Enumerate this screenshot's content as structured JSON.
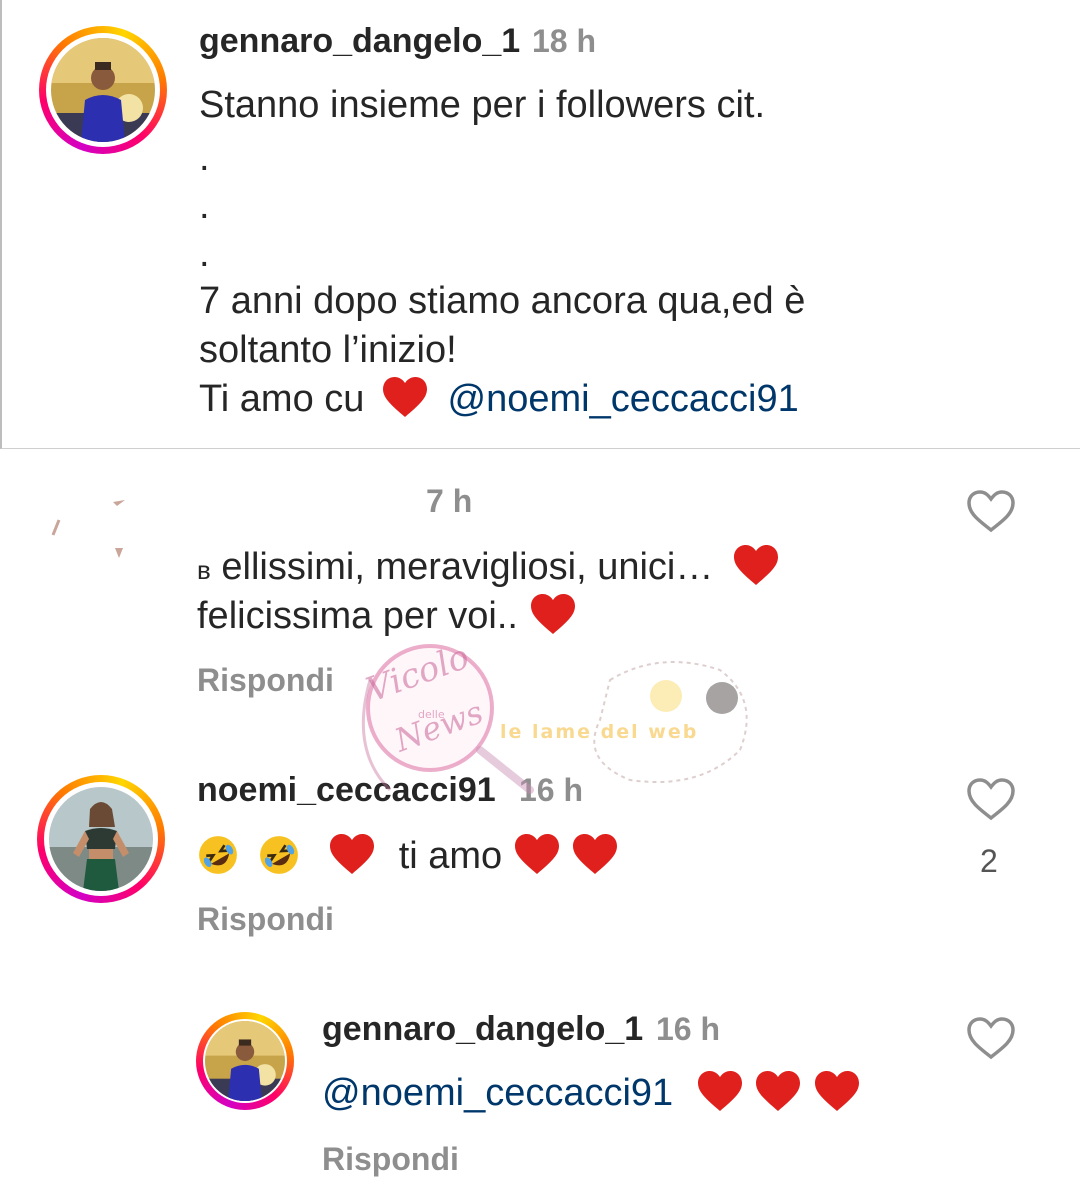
{
  "caption": {
    "username": "gennaro_dangelo_1",
    "time": "18 h",
    "line1": "Stanno insieme per i followers cit.",
    "dots": [
      ".",
      ".",
      "."
    ],
    "line2": "7 anni dopo stiamo ancora qua,ed è",
    "line3": "soltanto l’inizio!",
    "line4_prefix": "Ti amo cu",
    "line4_mention": "@noemi_ceccacci91"
  },
  "comments": [
    {
      "username": "",
      "time": "7 h",
      "line1": "ellissimi, meravigliosi, unici…",
      "line1_cut": "ʙ",
      "line2": "felicissima per voi..",
      "reply_label": "Rispondi"
    },
    {
      "username": "noemi_ceccacci91",
      "time": "16 h",
      "text": "ti amo",
      "reply_label": "Rispondi",
      "like_count": "2"
    },
    {
      "username": "gennaro_dangelo_1",
      "time": "16 h",
      "mention": "@noemi_ceccacci91",
      "reply_label": "Rispondi"
    }
  ],
  "watermark": {
    "left_text": "Vicolo",
    "left_small": "delle",
    "left_text2": "News",
    "right_text": "le lame del web"
  },
  "icons": {
    "heart_outline": "heart-outline-icon",
    "heart_red": "red-heart-emoji",
    "laugh": "rolling-on-floor-laughing-emoji"
  },
  "colors": {
    "mention": "#00376b",
    "heart": "#e0201c",
    "meta": "#8e8e8e"
  }
}
